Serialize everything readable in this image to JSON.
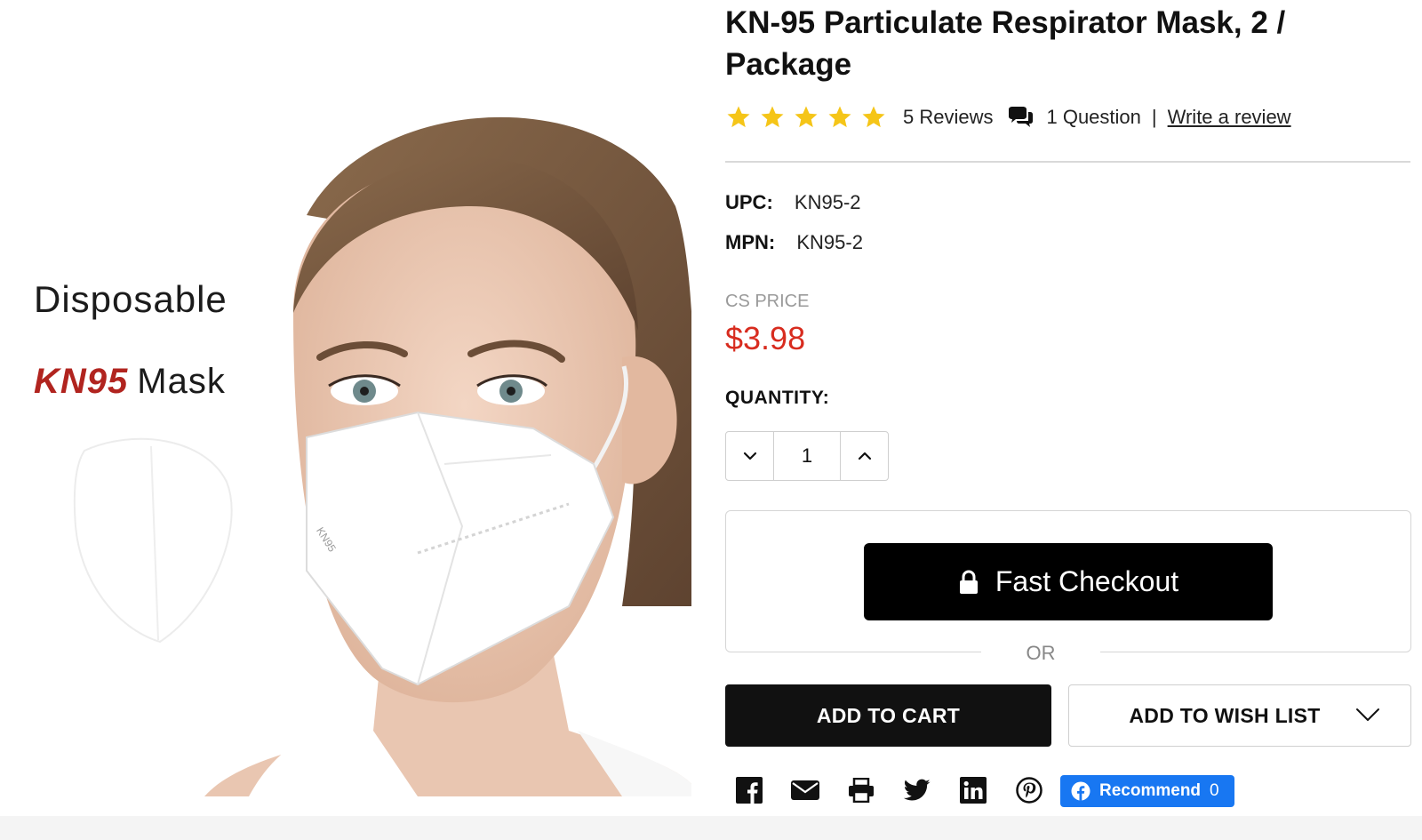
{
  "product": {
    "title": "KN-95 Particulate Respirator Mask, 2 / Package",
    "image": {
      "overlay_line_1": "Disposable",
      "overlay_brand": "KN95",
      "overlay_word": "Mask",
      "mask_print": "KN95"
    },
    "rating": {
      "stars": 5,
      "max_stars": 5,
      "star_color": "#f5c518"
    },
    "reviews_label": "5 Reviews",
    "questions_label": "1 Question",
    "separator": "|",
    "write_review_label": "Write a review",
    "upc_label": "UPC:",
    "upc_value": "KN95-2",
    "mpn_label": "MPN:",
    "mpn_value": "KN95-2",
    "price_label": "CS PRICE",
    "price_value": "$3.98",
    "price_color": "#d82c1f"
  },
  "quantity": {
    "label": "QUANTITY:",
    "value": "1",
    "decrease_icon": "chevron-down-icon",
    "increase_icon": "chevron-up-icon"
  },
  "checkout": {
    "fast_checkout_label": "Fast Checkout",
    "fast_checkout_icon": "lock-icon",
    "or_label": "OR"
  },
  "actions": {
    "add_to_cart_label": "ADD TO CART",
    "add_to_wishlist_label": "ADD TO WISH LIST",
    "wishlist_icon": "chevron-down-icon"
  },
  "share": {
    "icons": [
      "facebook-icon",
      "email-icon",
      "print-icon",
      "twitter-icon",
      "linkedin-icon",
      "pinterest-icon"
    ],
    "recommend_label": "Recommend",
    "recommend_count": "0",
    "facebook_blue": "#1877f2"
  }
}
